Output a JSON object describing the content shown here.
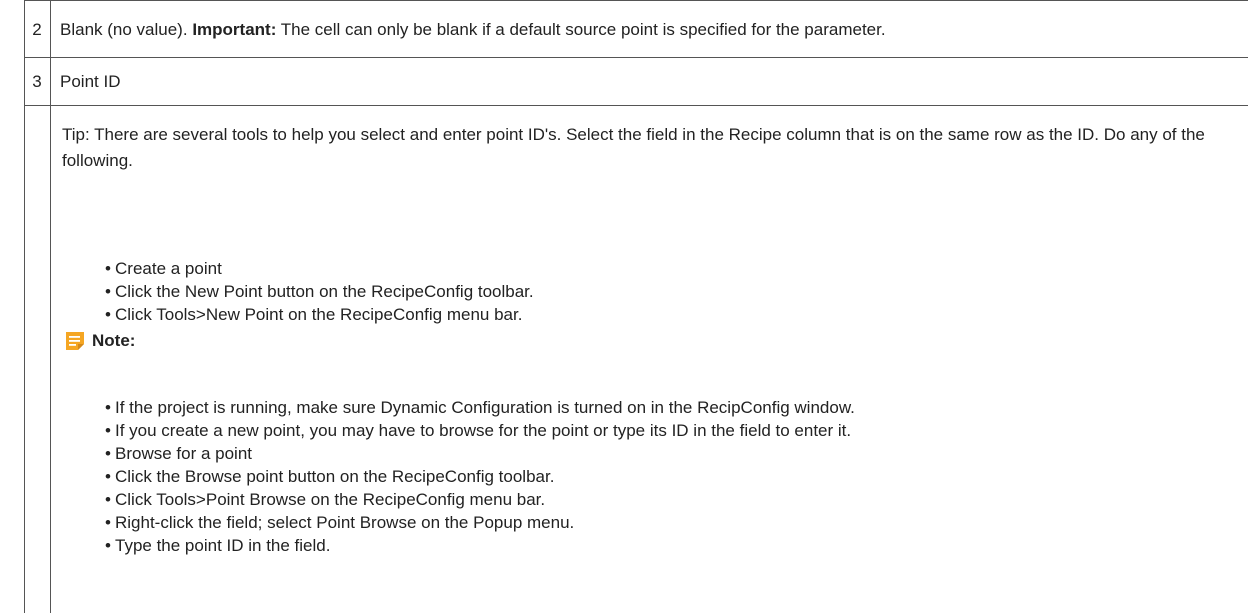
{
  "rows": [
    {
      "number": "2",
      "text_before": "Blank (no value).",
      "text_bold": "Important:",
      "text_after": "The cell can only be blank if a default source point is specified for the parameter."
    },
    {
      "number": "3",
      "text": "Point ID"
    }
  ],
  "tip": {
    "paragraph": "Tip: There are several tools to help you select and enter point ID's. Select the field in the Recipe column that is on the same row as the ID. Do any of the following.",
    "list_1": [
      "Create a point",
      "Click the New Point button on the RecipeConfig toolbar.",
      "Click Tools>New Point on the RecipeConfig menu bar."
    ],
    "note_label": "Note:",
    "note_icon": "note-icon",
    "list_2": [
      "If the project is running, make sure Dynamic Configuration is turned on in the RecipConfig window.",
      "If you create a new point, you may have to browse for the point or type its ID in the field to enter it.",
      "Browse for a point",
      "Click the Browse point button on the RecipeConfig toolbar.",
      "Click Tools>Point Browse on the RecipeConfig menu bar.",
      "Right-click the field; select Point Browse on the Popup menu.",
      "Type the point ID in the field."
    ]
  },
  "colors": {
    "note_icon_orange": "#f5a623",
    "border": "#555555",
    "text": "#222222"
  }
}
